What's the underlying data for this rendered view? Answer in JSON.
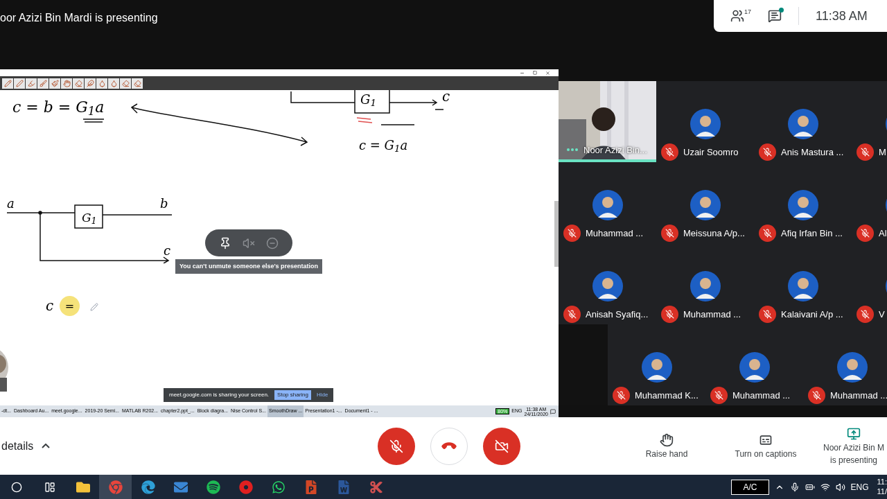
{
  "header": {
    "title": "oor Azizi Bin Mardi is presenting",
    "participant_count": "17",
    "chat_unread": true,
    "time": "11:38 AM"
  },
  "whiteboard": {
    "labels": [
      "c = b = G$_{1}$a",
      "G$_{1}$",
      "c",
      "c = G$_{1}$a",
      "a",
      "b",
      "G$_{1}$",
      "c",
      "c",
      "="
    ],
    "tooltip": "You can't unmute someone else's presentation",
    "share_bar": {
      "message": "meet.google.com is sharing your screen.",
      "stop": "Stop sharing",
      "hide": "Hide"
    },
    "taskbar_items": [
      {
        "label": "-dt...",
        "selected": false
      },
      {
        "label": "Dashboard Au...",
        "selected": false
      },
      {
        "label": "meet.google...",
        "selected": false
      },
      {
        "label": "2019-20 Semi...",
        "selected": false
      },
      {
        "label": "MATLAB R202...",
        "selected": false
      },
      {
        "label": "chapter2.ppt_...",
        "selected": false
      },
      {
        "label": "Block diagra...",
        "selected": false
      },
      {
        "label": "Nise Control S...",
        "selected": false
      },
      {
        "label": "SmoothDraw ...",
        "selected": true
      },
      {
        "label": "Presentation1 -...",
        "selected": false
      },
      {
        "label": "Document1 - ...",
        "selected": false
      }
    ],
    "tray": {
      "battery": "80%",
      "language": "ENG",
      "time": "11:38 AM",
      "date": "24/11/2020"
    }
  },
  "participants": [
    {
      "name": "Noor Azizi Bin...",
      "kind": "video",
      "muted": false,
      "speaking": true
    },
    {
      "name": "Uzair Soomro",
      "kind": "avatar",
      "muted": true,
      "speaking": false
    },
    {
      "name": "Anis Mastura ...",
      "kind": "avatar",
      "muted": true,
      "speaking": false
    },
    {
      "name": "M",
      "kind": "avatar",
      "muted": true,
      "speaking": false
    },
    {
      "name": "Muhammad ...",
      "kind": "avatar",
      "muted": true,
      "speaking": false
    },
    {
      "name": "Meissuna A/p...",
      "kind": "avatar",
      "muted": true,
      "speaking": false
    },
    {
      "name": "Afiq Irfan Bin ...",
      "kind": "avatar",
      "muted": true,
      "speaking": false
    },
    {
      "name": "Al",
      "kind": "avatar",
      "muted": true,
      "speaking": false
    },
    {
      "name": "Anisah Syafiq...",
      "kind": "avatar",
      "muted": true,
      "speaking": false
    },
    {
      "name": "Muhammad ...",
      "kind": "avatar",
      "muted": true,
      "speaking": false
    },
    {
      "name": "Kalaivani A/p ...",
      "kind": "avatar",
      "muted": true,
      "speaking": false
    },
    {
      "name": "V",
      "kind": "avatar",
      "muted": true,
      "speaking": false
    },
    {
      "name": "Muhammad K...",
      "kind": "avatar",
      "muted": true,
      "speaking": false
    },
    {
      "name": "Muhammad ...",
      "kind": "avatar",
      "muted": true,
      "speaking": false
    },
    {
      "name": "Muhammad ...",
      "kind": "avatar",
      "muted": true,
      "speaking": false
    }
  ],
  "controls": {
    "details": "details",
    "mic_muted": true,
    "camera_off": true
  },
  "actions": [
    {
      "kind": "hand",
      "lines": [
        "Raise hand"
      ]
    },
    {
      "kind": "captions",
      "lines": [
        "Turn on captions"
      ]
    },
    {
      "kind": "present",
      "lines": [
        "Noor Azizi Bin M",
        "is presenting"
      ]
    }
  ],
  "taskbar": {
    "apps": [
      {
        "kind": "folder",
        "selected": false
      },
      {
        "kind": "browser",
        "selected": true
      },
      {
        "kind": "edge",
        "selected": false
      },
      {
        "kind": "mail",
        "selected": false
      },
      {
        "kind": "music",
        "selected": false
      },
      {
        "kind": "record",
        "selected": false
      },
      {
        "kind": "chat",
        "selected": false
      },
      {
        "kind": "slides",
        "selected": false
      },
      {
        "kind": "document",
        "selected": false
      },
      {
        "kind": "scissors",
        "selected": false
      }
    ],
    "power": "A/C",
    "language": "ENG",
    "time": "11:",
    "date": "11/"
  }
}
